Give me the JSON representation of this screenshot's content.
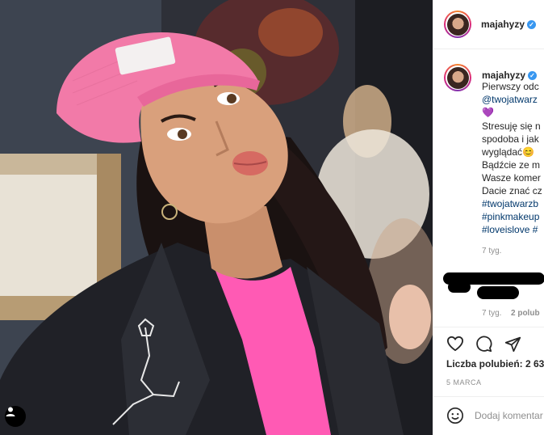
{
  "post": {
    "username": "majahyzy",
    "verified_mark": "✓",
    "caption_lines": [
      "Pierwszy odc",
      "@twojatwarz",
      "💜",
      "Stresuję się n",
      "spodoba i jak",
      "wyglądać😊",
      "Bądźcie ze m",
      "Wasze komer",
      "Dacie znać cz",
      "#twojatwarzb",
      "#pinkmakeup",
      "#loveislove #"
    ],
    "caption_time": "7 tyg.",
    "comment_time": "7 tyg.",
    "comment_reply": "2 polub",
    "likes": "Liczba polubień: 2 63",
    "date": "5 MARCA",
    "comment_placeholder": "Dodaj komentar"
  },
  "icons": {
    "verified": "verified-badge-icon",
    "like": "heart-icon",
    "comment": "comment-icon",
    "share": "paper-plane-icon",
    "emoji": "emoji-icon",
    "user_tag": "user-icon"
  },
  "colors": {
    "link": "#00376b",
    "verified": "#3897f0",
    "muted": "#8e8e8e",
    "beanie": "#f27aa8",
    "shirt": "#ff5ab4"
  }
}
